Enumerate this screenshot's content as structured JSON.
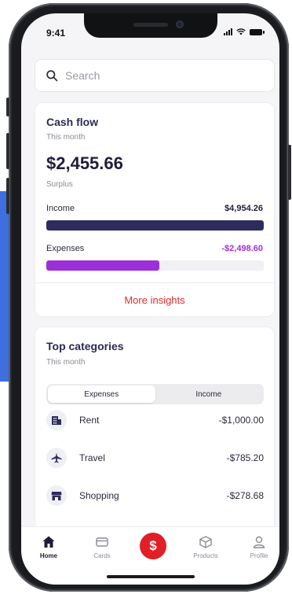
{
  "status": {
    "time": "9:41"
  },
  "search": {
    "placeholder": "Search"
  },
  "cashflow": {
    "title": "Cash flow",
    "period": "This month",
    "amount": "$2,455.66",
    "amount_label": "Surplus",
    "income_label": "Income",
    "income_value": "$4,954.26",
    "income_fraction": 1.0,
    "expenses_label": "Expenses",
    "expenses_value": "-$2,498.60",
    "expenses_fraction": 0.52,
    "more_label": "More insights"
  },
  "categories": {
    "title": "Top categories",
    "period": "This month",
    "tabs": [
      "Expenses",
      "Income"
    ],
    "active_tab": "Expenses",
    "items": [
      {
        "name": "Rent",
        "value": "-$1,000.00",
        "icon": "building-icon"
      },
      {
        "name": "Travel",
        "value": "-$785.20",
        "icon": "airplane-icon"
      },
      {
        "name": "Shopping",
        "value": "-$278.68",
        "icon": "store-icon"
      }
    ]
  },
  "tabbar": {
    "items": [
      {
        "label": "Home",
        "icon": "home-icon",
        "active": true
      },
      {
        "label": "Cards",
        "icon": "card-icon",
        "active": false
      },
      {
        "label": "Products",
        "icon": "box-icon",
        "active": false
      },
      {
        "label": "Profile",
        "icon": "person-icon",
        "active": false
      }
    ],
    "center_symbol": "$"
  },
  "colors": {
    "income_bar": "#2e2b5f",
    "expenses_bar": "#9b30d9",
    "expenses_text": "#a22ee0",
    "accent_red": "#e01f26",
    "side_strip": "#3d6fe0"
  }
}
